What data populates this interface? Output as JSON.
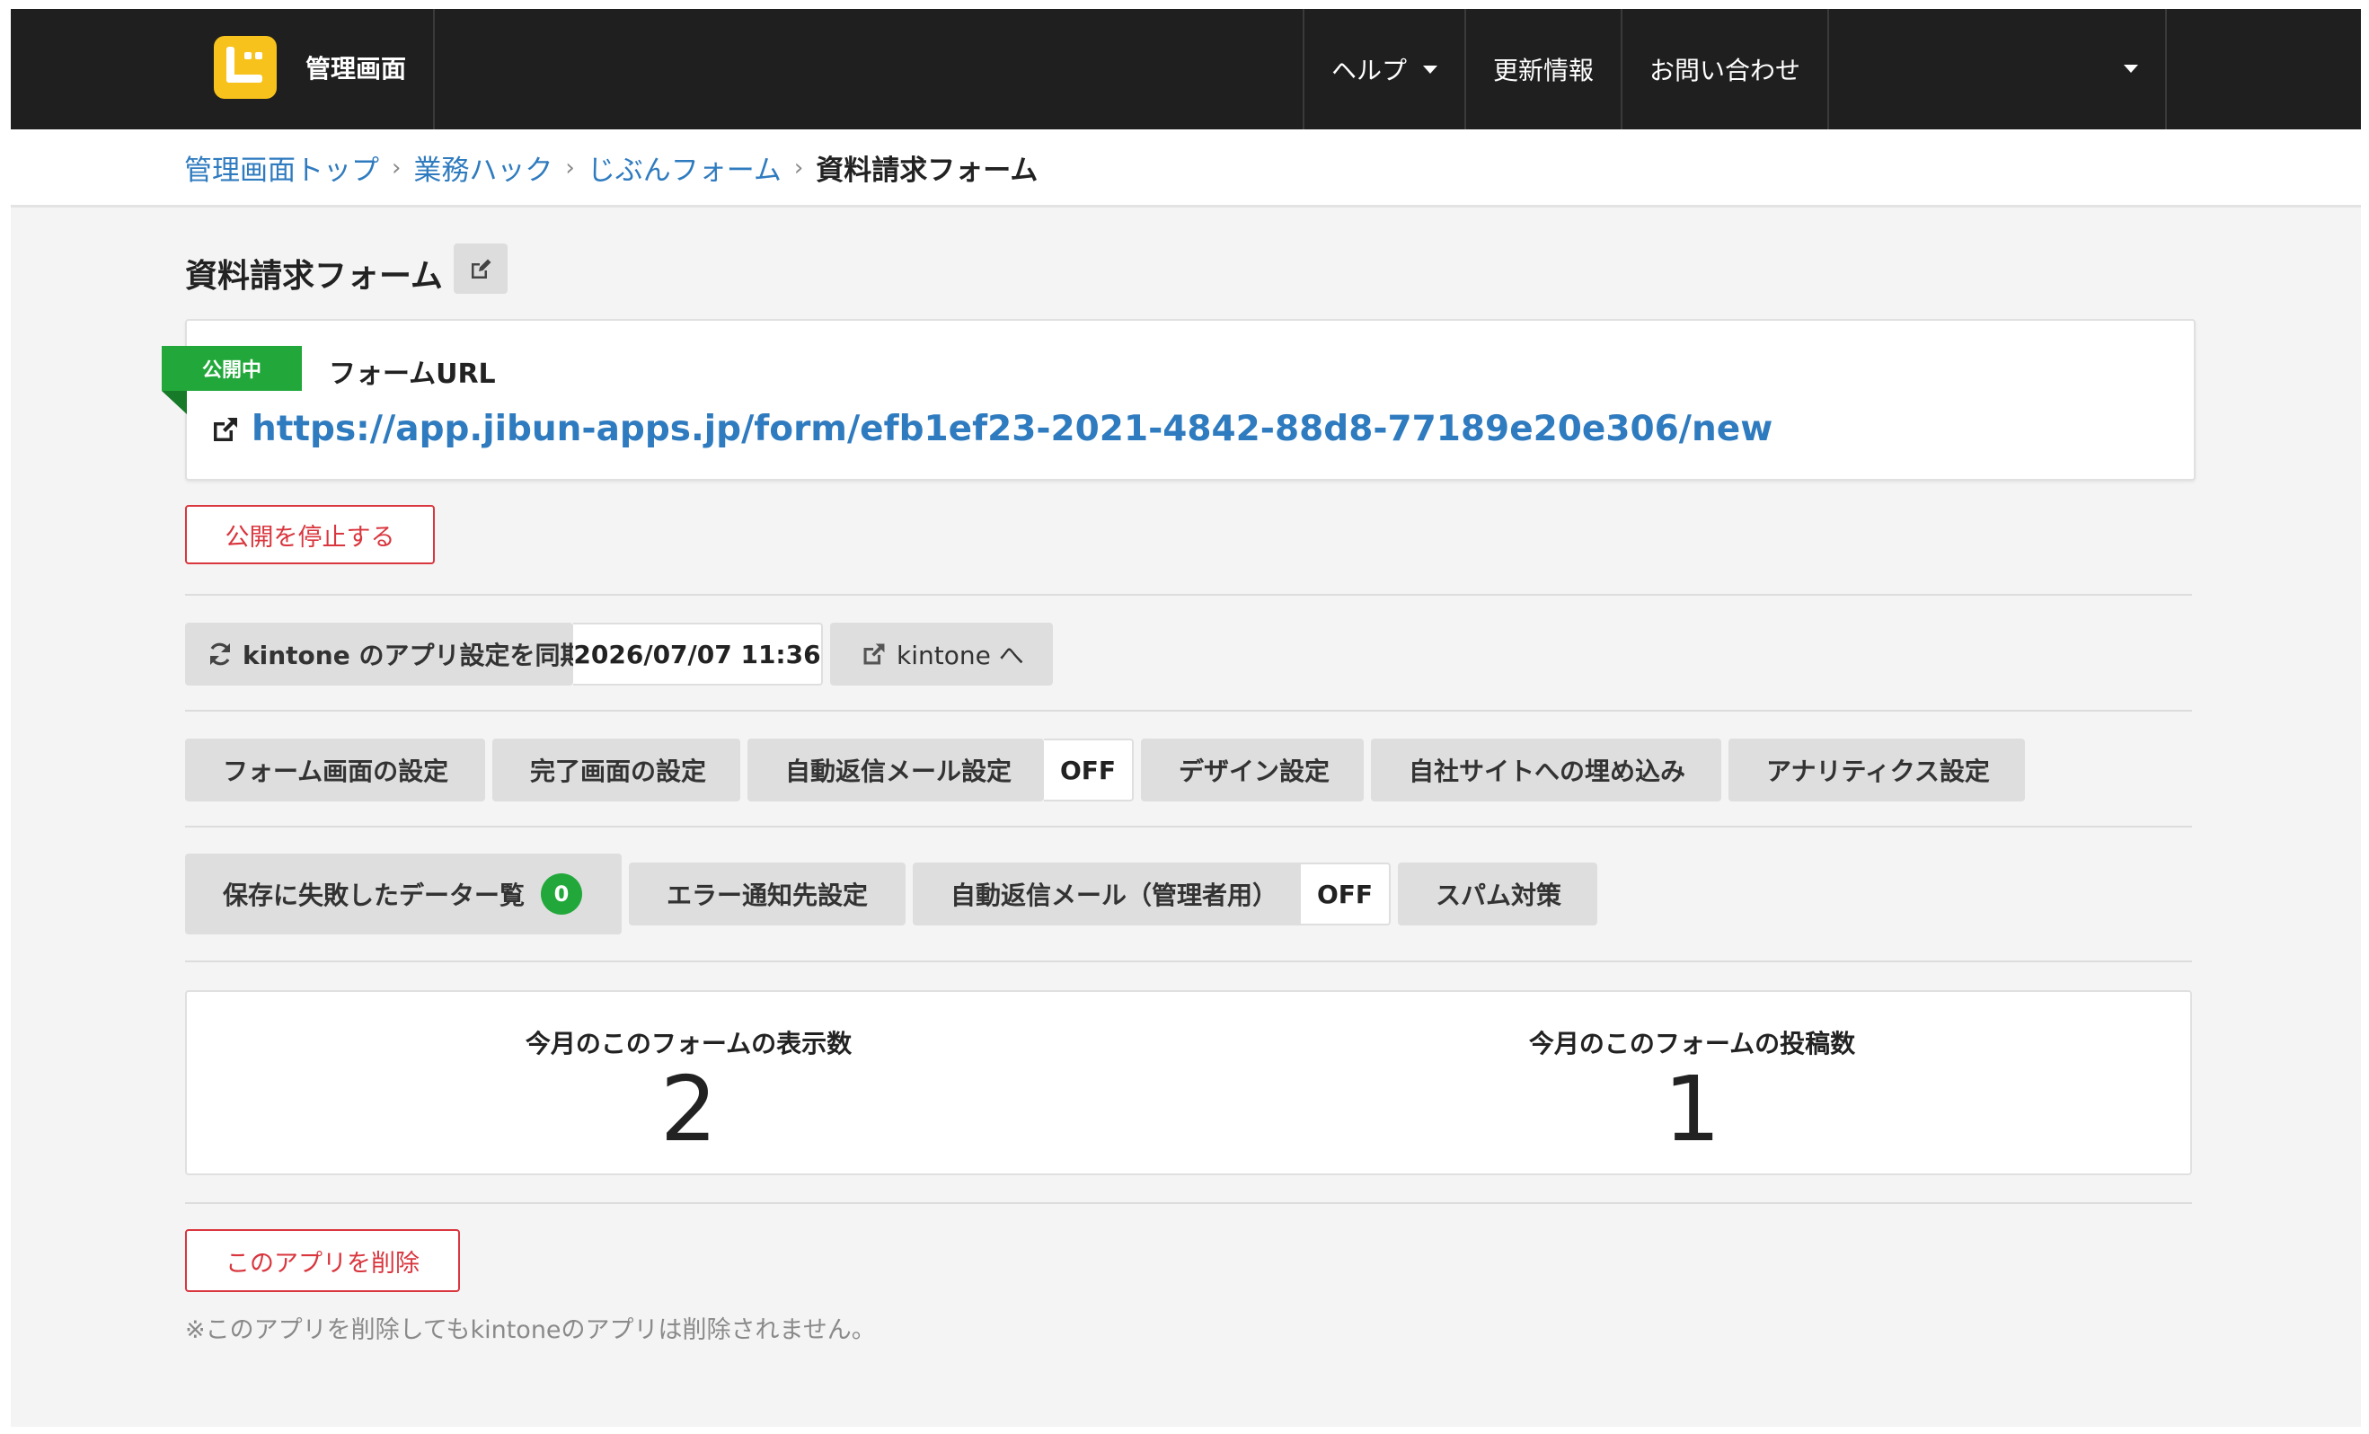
{
  "header": {
    "brand_label": "管理画面",
    "nav": {
      "help": "ヘルプ",
      "updates": "更新情報",
      "contact": "お問い合わせ"
    }
  },
  "breadcrumb": {
    "items": [
      "管理画面トップ",
      "業務ハック",
      "じぶんフォーム"
    ],
    "current": "資料請求フォーム"
  },
  "page": {
    "title": "資料請求フォーム"
  },
  "url_card": {
    "status_badge": "公開中",
    "label": "フォームURL",
    "url": "https://app.jibun-apps.jp/form/efb1ef23-2021-4842-88d8-77189e20e306/new"
  },
  "actions": {
    "stop_publish": "公開を停止する",
    "delete_app": "このアプリを削除",
    "delete_note": "※このアプリを削除してもkintoneのアプリは削除されません。"
  },
  "sync": {
    "sync_label": "kintone のアプリ設定を同期",
    "last_synced": "2026/07/07 11:36",
    "open_kintone": "kintone へ"
  },
  "settings_row1": {
    "form_screen": "フォーム画面の設定",
    "complete_screen": "完了画面の設定",
    "auto_reply": "自動返信メール設定",
    "auto_reply_status": "OFF",
    "design": "デザイン設定",
    "embed": "自社サイトへの埋め込み",
    "analytics": "アナリティクス設定"
  },
  "settings_row2": {
    "failed_data": "保存に失敗したデーター覧",
    "failed_count": "0",
    "error_notify": "エラー通知先設定",
    "auto_reply_admin": "自動返信メール（管理者用）",
    "auto_reply_admin_status": "OFF",
    "spam": "スパム対策"
  },
  "stats": {
    "views_label": "今月のこのフォームの表示数",
    "views_value": "2",
    "posts_label": "今月のこのフォームの投稿数",
    "posts_value": "1"
  },
  "colors": {
    "topbar": "#1f1f1f",
    "accent_yellow": "#f7c21b",
    "link_blue": "#2f7bbf",
    "success_green": "#22a83a",
    "danger_red": "#d9363e"
  }
}
